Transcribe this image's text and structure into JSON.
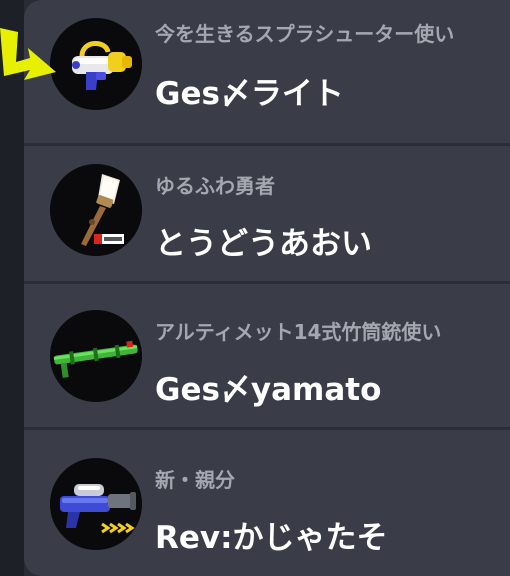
{
  "players": [
    {
      "title": "今を生きるスプラシューター使い",
      "name": "Ges〆ライト",
      "weapon_icon": "splattershot-icon",
      "selected": true
    },
    {
      "title": "ゆるふわ勇者",
      "name": "とうどうあおい",
      "weapon_icon": "paintbrush-icon",
      "selected": false
    },
    {
      "title": "アルティメット14式竹筒銃使い",
      "name": "Ges〆yamato",
      "weapon_icon": "bamboozler-icon",
      "selected": false
    },
    {
      "title": "新・親分",
      "name": "Rev:かじゃたそ",
      "weapon_icon": "blaster-icon",
      "selected": false
    }
  ],
  "colors": {
    "panel": "#3a3d47",
    "title_text": "#a4a7b0",
    "name_text": "#ffffff",
    "pointer": "#e6f000"
  }
}
